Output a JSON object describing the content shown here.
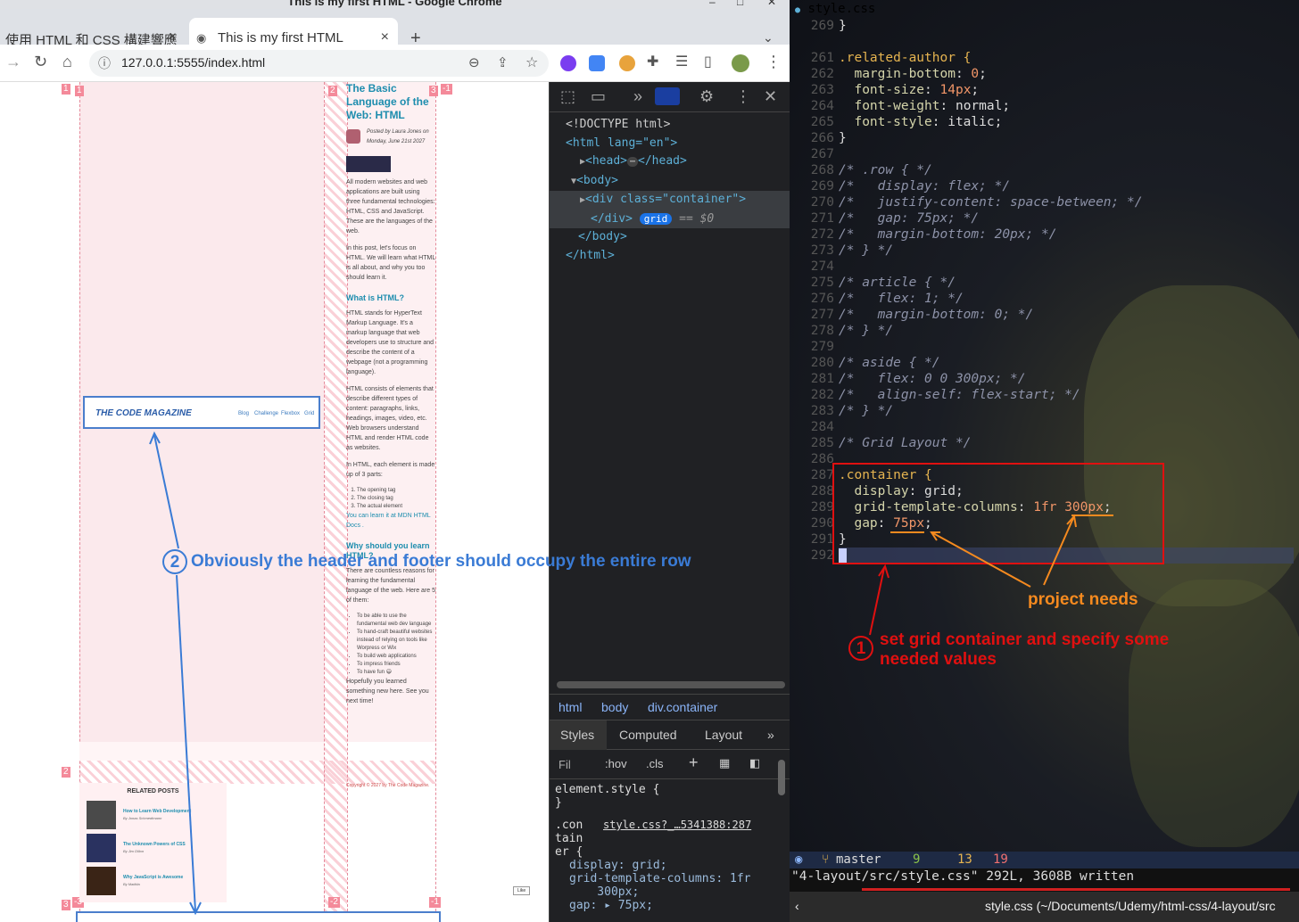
{
  "window": {
    "title": "This is my first HTML - Google Chrome"
  },
  "tabs": [
    {
      "label": "使用 HTML 和 CSS 構建響應",
      "close": "×"
    },
    {
      "label": "This is my first HTML",
      "close": "×"
    }
  ],
  "new_tab": "+",
  "address": {
    "url": "127.0.0.1:5555/index.html"
  },
  "page": {
    "grid_numbers": {
      "top_left": "1",
      "col1": "1",
      "col2": "2",
      "col3": "3",
      "col3_neg": "-1",
      "row2": "2",
      "row3": "3",
      "neg3": "-3",
      "neg2": "-2",
      "neg1": "-1"
    },
    "header": {
      "logo": "THE CODE MAGAZINE",
      "nav": [
        "Blog",
        "Challenge",
        "Flexbox",
        "Grid"
      ]
    },
    "article": {
      "title": "The Basic Language of the Web: HTML",
      "meta": "Posted by Laura Jones on Monday, June 21st 2027",
      "p1": "All modern websites and web applications are built using three fundamental technologies: HTML, CSS and JavaScript. These are the languages of the web.",
      "p2": "In this post, let's focus on HTML. We will learn what HTML is all about, and why you too should learn it.",
      "h2a": "What is HTML?",
      "p3": "HTML stands for HyperText Markup Language. It's a markup language that web developers use to structure and describe the content of a webpage (not a programming language).",
      "p4": "HTML consists of elements that describe different types of content: paragraphs, links, headings, images, video, etc. Web browsers understand HTML and render HTML code as websites.",
      "p5": "In HTML, each element is made up of 3 parts:",
      "parts": [
        "The opening tag",
        "The closing tag",
        "The actual element"
      ],
      "mdn": "You can learn it at MDN HTML Docs .",
      "h2b": "Why should you learn HTML?",
      "p6": "There are countless reasons for learning the fundamental language of the web. Here are 5 of them:",
      "reasons": [
        "To be able to use the fundamental web dev language",
        "To hand-craft beautiful websites instead of relying on tools like Worpress or Wix",
        "To build web applications",
        "To impress friends",
        "To have fun 😃"
      ],
      "p7": "Hopefully you learned something new here. See you next time!"
    },
    "footer": "Copyright © 2027 by The Code Magazine.",
    "related": {
      "heading": "RELATED POSTS",
      "posts": [
        {
          "title": "How to Learn Web Development",
          "by": "By Jonas Schmedtmann"
        },
        {
          "title": "The Unknown Powers of CSS",
          "by": "By Jim Dillon"
        },
        {
          "title": "Why JavaScript is Awesome",
          "by": "By Matilda"
        }
      ]
    },
    "like": "Like"
  },
  "devtools": {
    "dom": [
      "<!DOCTYPE html>",
      "<html lang=\"en\">",
      "<head>",
      "</head>",
      "<body>",
      "<div class=\"container\">",
      "</div>",
      "grid",
      "== $0",
      "</body>",
      "</html>"
    ],
    "crumbs": [
      "html",
      "body",
      "div.container"
    ],
    "tabs": [
      "Styles",
      "Computed",
      "Layout",
      "»"
    ],
    "filter": {
      "placeholder": "Fil",
      "hov": ":hov",
      "cls": ".cls",
      "plus": "+"
    },
    "styles": {
      "element_style": "element.style {",
      "close": "}",
      "selector": ".con\ntain\ner {",
      "source": "style.css?_…5341388:287",
      "decls": [
        "display: grid;",
        "grid-template-columns: 1fr\n    300px;",
        "gap: ▸ 75px;"
      ]
    }
  },
  "editor": {
    "filename": "style.css",
    "lines": [
      {
        "n": "269",
        "t": "}"
      },
      {
        "n": "",
        "t": ""
      },
      {
        "n": "261",
        "t": ".related-author {"
      },
      {
        "n": "262",
        "t": "  margin-bottom: 0;"
      },
      {
        "n": "263",
        "t": "  font-size: 14px;"
      },
      {
        "n": "264",
        "t": "  font-weight: normal;"
      },
      {
        "n": "265",
        "t": "  font-style: italic;"
      },
      {
        "n": "266",
        "t": "}"
      },
      {
        "n": "267",
        "t": ""
      },
      {
        "n": "268",
        "t": "/* .row { */"
      },
      {
        "n": "269",
        "t": "/*   display: flex; */"
      },
      {
        "n": "270",
        "t": "/*   justify-content: space-between; */"
      },
      {
        "n": "271",
        "t": "/*   gap: 75px; */"
      },
      {
        "n": "272",
        "t": "/*   margin-bottom: 20px; */"
      },
      {
        "n": "273",
        "t": "/* } */"
      },
      {
        "n": "274",
        "t": ""
      },
      {
        "n": "275",
        "t": "/* article { */"
      },
      {
        "n": "276",
        "t": "/*   flex: 1; */"
      },
      {
        "n": "277",
        "t": "/*   margin-bottom: 0; */"
      },
      {
        "n": "278",
        "t": "/* } */"
      },
      {
        "n": "279",
        "t": ""
      },
      {
        "n": "280",
        "t": "/* aside { */"
      },
      {
        "n": "281",
        "t": "/*   flex: 0 0 300px; */"
      },
      {
        "n": "282",
        "t": "/*   align-self: flex-start; */"
      },
      {
        "n": "283",
        "t": "/* } */"
      },
      {
        "n": "284",
        "t": ""
      },
      {
        "n": "285",
        "t": "/* Grid Layout */"
      },
      {
        "n": "286",
        "t": ""
      },
      {
        "n": "287",
        "t": ".container {"
      },
      {
        "n": "288",
        "t": "  display: grid;"
      },
      {
        "n": "289",
        "t": "  grid-template-columns: 1fr 300px;"
      },
      {
        "n": "290",
        "t": "  gap: 75px;"
      },
      {
        "n": "291",
        "t": "}"
      },
      {
        "n": "292",
        "t": ""
      }
    ],
    "status": {
      "branch": "master",
      "a": "9",
      "b": "13",
      "c": "19"
    },
    "cmdline": "\"4-layout/src/style.css\" 292L, 3608B written",
    "bottom": "style.css (~/Documents/Udemy/html-css/4-layout/src"
  },
  "annotations": {
    "one_num": "1",
    "one": "set grid container and specify some needed values",
    "two_num": "2",
    "two": "Obviously the header and footer should occupy the entire row",
    "project": "project needs"
  },
  "colors": {
    "red": "#e01010",
    "orange": "#f58a1f",
    "blue": "#3a7bd5"
  }
}
